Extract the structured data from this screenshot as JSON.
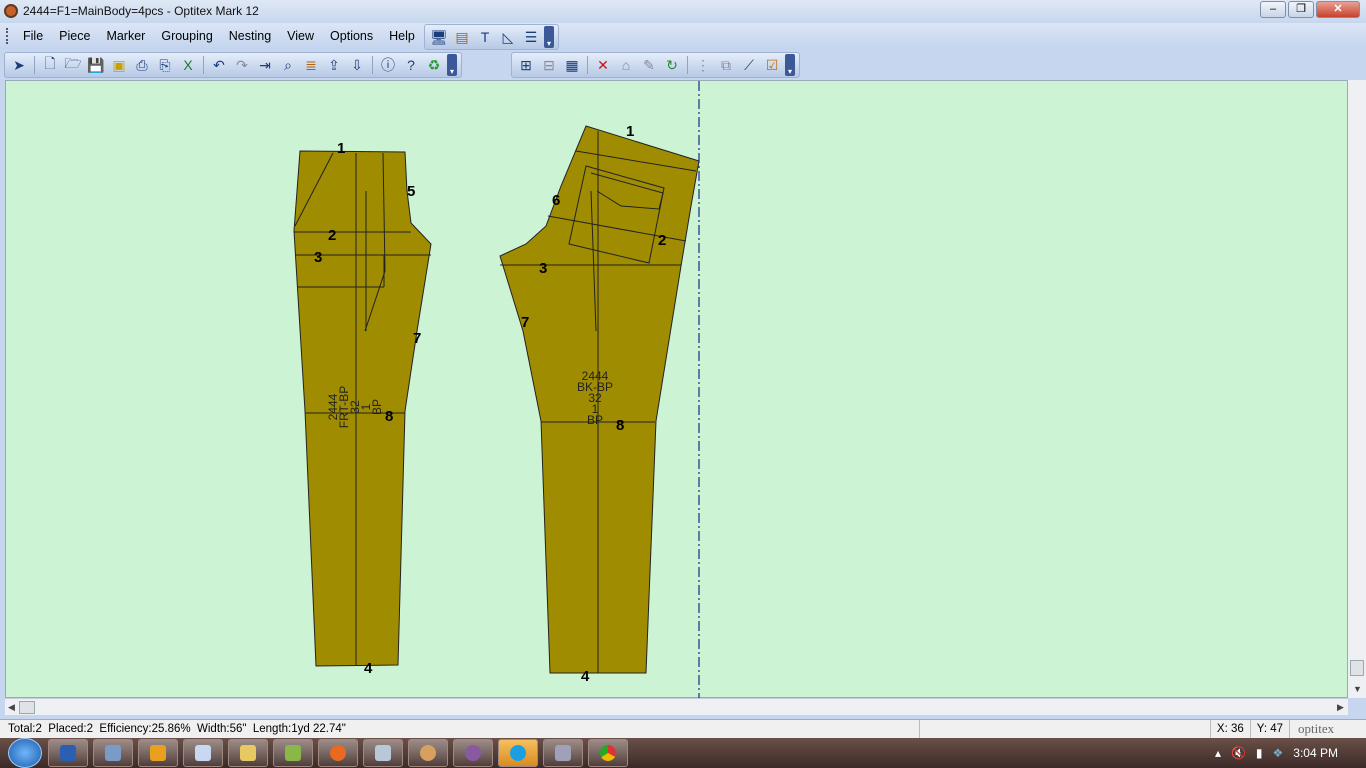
{
  "window": {
    "title": "2444=F1=MainBody=4pcs - Optitex Mark 12",
    "controls": [
      "minimize",
      "restore",
      "close"
    ]
  },
  "menu": [
    "File",
    "Piece",
    "Marker",
    "Grouping",
    "Nesting",
    "View",
    "Options",
    "Help"
  ],
  "view_toolbar": [
    "monitor-icon",
    "note-icon",
    "text-icon",
    "ruler-icon",
    "list-icon"
  ],
  "toolbar": [
    "select-icon",
    "new-icon",
    "open-icon",
    "save-icon",
    "export-icon",
    "print-icon",
    "plot-icon",
    "excel-icon",
    "undo-icon",
    "redo-icon",
    "import-icon",
    "find-icon",
    "report-icon",
    "upload-icon",
    "download-icon",
    "info-icon",
    "help-icon",
    "recycle-icon"
  ],
  "toolbar2": [
    "group-icon",
    "ungroup-icon",
    "nest-icon",
    "delete-icon",
    "lock-icon",
    "edit-icon",
    "refresh-icon",
    "align-icon",
    "overlay-icon",
    "measure-icon",
    "check-icon"
  ],
  "pieces": {
    "front": {
      "labels": [
        "2444",
        "FRT-BP",
        "32",
        "1",
        "BP"
      ],
      "points": [
        "1",
        "2",
        "3",
        "4",
        "5",
        "7",
        "8"
      ]
    },
    "back": {
      "labels": [
        "2444",
        "BK-BP",
        "32",
        "1",
        "BP"
      ],
      "points": [
        "1",
        "2",
        "3",
        "4",
        "6",
        "7",
        "8"
      ]
    },
    "fill_color": "#a08c00"
  },
  "status": {
    "summary": "Total:2  Placed:2  Efficiency:25.86%  Width:56\"  Length:1yd 22.74\"",
    "x": "X: 36",
    "y": "Y: 47",
    "brand": "optitex"
  },
  "taskbar": {
    "apps": [
      "word",
      "explorer",
      "outlook",
      "cloud",
      "folder",
      "paint",
      "firefox",
      "calculator",
      "palette",
      "optitex",
      "skype",
      "device",
      "chrome"
    ],
    "clock": "3:04 PM"
  }
}
